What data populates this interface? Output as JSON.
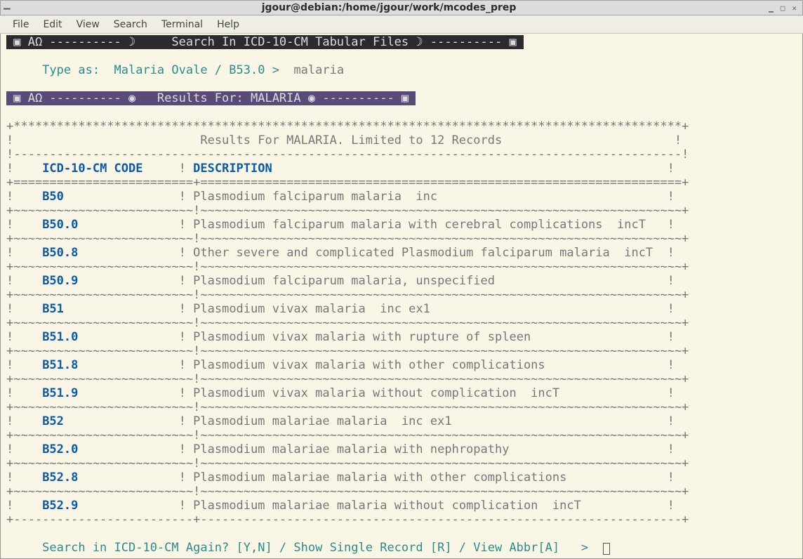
{
  "window": {
    "title": "jgour@debian:/home/jgour/work/mcodes_prep"
  },
  "menu": {
    "file": "File",
    "edit": "Edit",
    "view": "View",
    "search": "Search",
    "terminal": "Terminal",
    "help": "Help"
  },
  "header_bar": " ▣ AΩ ---------- ☽     Search In ICD-10-CM Tabular Files ☽ ---------- ▣ ",
  "prompt": {
    "label": "     Type as:  Malaria Ovale / B53.0 >  ",
    "input": "malaria"
  },
  "results_bar": " ▣ AΩ ---------- ◉   Results For: MALARIA ◉ ---------- ▣ ",
  "table": {
    "caption": "                         Results For MALARIA. Limited to 12 Records",
    "col1": "ICD-10-CM CODE",
    "col2": "DESCRIPTION"
  },
  "rows": [
    {
      "code": "B50",
      "desc": "Plasmodium falciparum malaria  inc"
    },
    {
      "code": "B50.0",
      "desc": "Plasmodium falciparum malaria with cerebral complications  incT"
    },
    {
      "code": "B50.8",
      "desc": "Other severe and complicated Plasmodium falciparum malaria  incT"
    },
    {
      "code": "B50.9",
      "desc": "Plasmodium falciparum malaria, unspecified"
    },
    {
      "code": "B51",
      "desc": "Plasmodium vivax malaria  inc ex1"
    },
    {
      "code": "B51.0",
      "desc": "Plasmodium vivax malaria with rupture of spleen"
    },
    {
      "code": "B51.8",
      "desc": "Plasmodium vivax malaria with other complications"
    },
    {
      "code": "B51.9",
      "desc": "Plasmodium vivax malaria without complication  incT"
    },
    {
      "code": "B52",
      "desc": "Plasmodium malariae malaria  inc ex1"
    },
    {
      "code": "B52.0",
      "desc": "Plasmodium malariae malaria with nephropathy"
    },
    {
      "code": "B52.8",
      "desc": "Plasmodium malariae malaria with other complications"
    },
    {
      "code": "B52.9",
      "desc": "Plasmodium malariae malaria without complication  incT"
    }
  ],
  "footer": {
    "prompt": "     Search in ICD-10-CM Again? [Y,N] / Show Single Record [R] / View Abbr[A]   >  "
  },
  "sep": {
    "stars": "+*********************************************************************************************+",
    "dashes": "!---------------------------------------------------------------------------------------------!",
    "equals": "+=========================+===================================================================+",
    "tildes": "+~~~~~~~~~~~~~~~~~~~~~~~~~!~~~~~~~~~~~~~~~~~~~~~~~~~~~~~~~~~~~~~~~~~~~~~~~~~~~~~~~~~~~~~~~~~~~+",
    "bottom": "+-------------------------+-------------------------------------------------------------------+"
  }
}
